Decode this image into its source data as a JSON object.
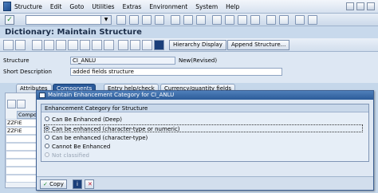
{
  "menu": {
    "items": [
      "Structure",
      "Edit",
      "Goto",
      "Utilities",
      "Extras",
      "Environment",
      "System",
      "Help"
    ]
  },
  "title": "Dictionary: Maintain Structure",
  "toolbar": {
    "hierarchy_display": "Hierarchy Display",
    "append_structure": "Append Structure..."
  },
  "form": {
    "structure_label": "Structure",
    "structure_value": "CI_ANLU",
    "structure_status": "New(Revised)",
    "short_desc_label": "Short Description",
    "short_desc_value": "added fields structure"
  },
  "tabs": [
    "Attributes",
    "Components",
    "Entry help/check",
    "Currency/quantity fields"
  ],
  "table": {
    "header": "Compo",
    "rows": [
      "ZZFIE",
      "ZZFIE"
    ]
  },
  "dialog": {
    "title": "Maintain Enhancement Category for CI_ANLU",
    "group_title": "Enhancement Category for Structure",
    "options": [
      "Can Be Enhanced (Deep)",
      "Can be enhanced (character-type or numeric)",
      "Can be enhanced (character-type)",
      "Cannot Be Enhanced",
      "Not classified"
    ],
    "selected_index": 1,
    "copy_label": "Copy"
  },
  "colors": {
    "title_bar": "#2b5b98",
    "active_tab": "#2a5a9a",
    "background": "#c5d7ea"
  }
}
